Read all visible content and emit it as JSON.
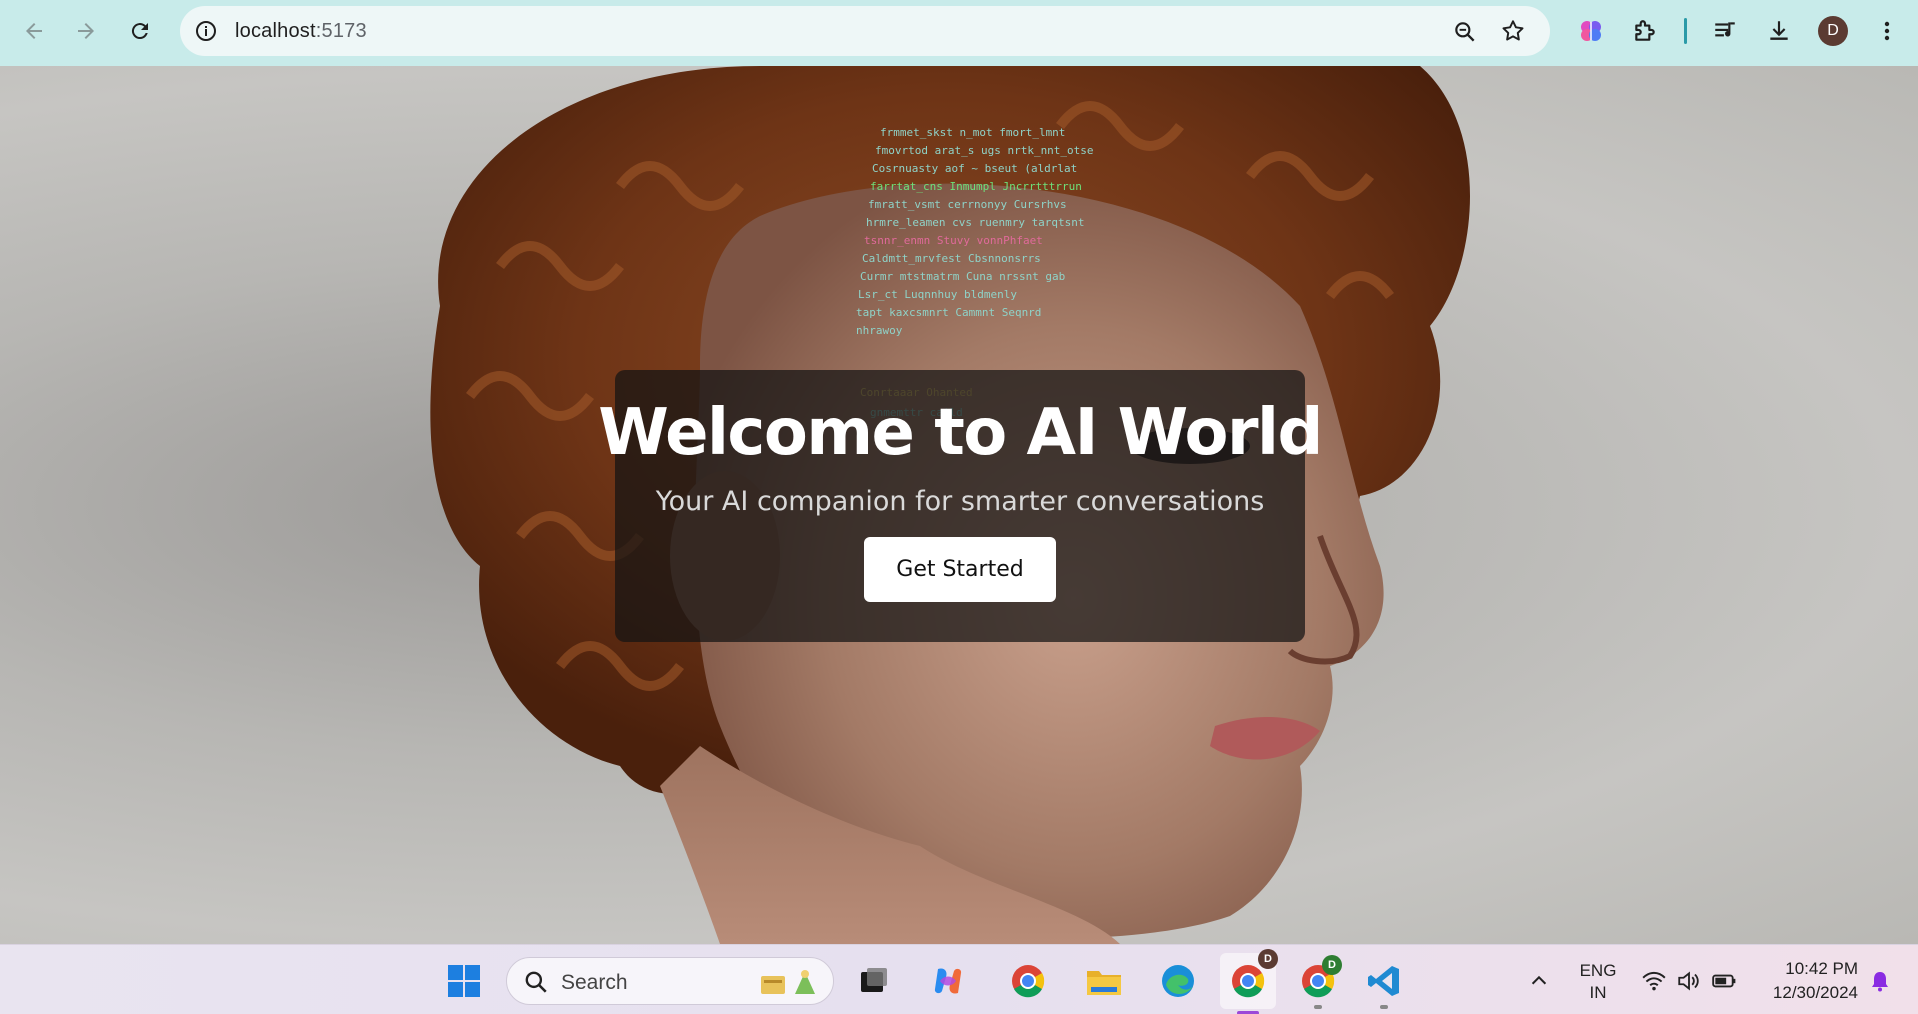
{
  "browser": {
    "url_host": "localhost",
    "url_port": ":5173",
    "avatar_initial": "D"
  },
  "hero": {
    "title": "Welcome to AI World",
    "subtitle": "Your AI companion for smarter conversations",
    "cta_label": "Get Started"
  },
  "taskbar": {
    "search_placeholder": "Search",
    "lang_line1": "ENG",
    "lang_line2": "IN",
    "time": "10:42 PM",
    "date": "12/30/2024",
    "chrome_profile_badge_1": "D",
    "chrome_profile_badge_2": "D"
  },
  "icons": [
    "back-arrow-icon",
    "forward-arrow-icon",
    "reload-icon",
    "site-info-icon",
    "zoom-icon",
    "bookmark-star-icon",
    "extension-brain-icon",
    "extensions-puzzle-icon",
    "media-queue-icon",
    "download-icon",
    "more-vert-icon",
    "windows-start-icon",
    "search-icon",
    "task-view-icon",
    "copilot-icon",
    "chrome-icon",
    "file-explorer-icon",
    "edge-icon",
    "vscode-icon",
    "chevron-up-icon",
    "wifi-icon",
    "volume-icon",
    "battery-icon",
    "notification-bell-icon"
  ],
  "colors": {
    "browser_bar": "#c8ebea",
    "accent": "#9b48d8",
    "card_bg": "rgba(20,20,20,0.72)"
  }
}
